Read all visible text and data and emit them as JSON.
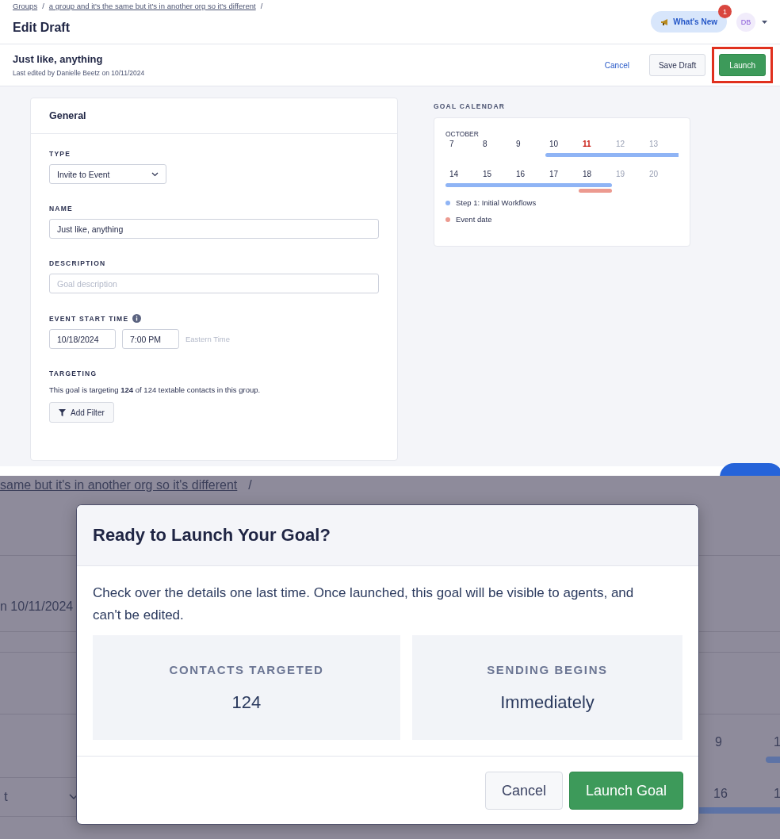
{
  "header": {
    "breadcrumbs": [
      {
        "label": "Groups"
      },
      {
        "label": "a group and it's the same but it's in another org so it's different"
      }
    ],
    "separator": "/",
    "title": "Edit Draft",
    "whats_new": {
      "label": "What's New",
      "badge": "1"
    },
    "avatar": "DB"
  },
  "draft_bar": {
    "name": "Just like, anything",
    "edited": "Last edited by Danielle Beetz on 10/11/2024",
    "buttons": [
      {
        "kind": "link",
        "label": "Cancel",
        "highlighted": false
      },
      {
        "kind": "secondary",
        "label": "Save Draft",
        "highlighted": false
      },
      {
        "kind": "primary",
        "label": "Launch",
        "highlighted": true
      }
    ]
  },
  "general": {
    "title": "General",
    "type": {
      "label": "TYPE",
      "value": "Invite to Event"
    },
    "name": {
      "label": "NAME",
      "value": "Just like, anything"
    },
    "description": {
      "label": "DESCRIPTION",
      "placeholder": "Goal description"
    },
    "event_start": {
      "label": "EVENT START TIME",
      "date": "10/18/2024",
      "time": "7:00 PM",
      "timezone": "Eastern Time"
    },
    "targeting": {
      "label": "TARGETING",
      "text": "This goal is targeting **124** of 124 textable contacts in this group.",
      "button": "Add Filter"
    }
  },
  "goal_calendar": {
    "title": "GOAL CALENDAR",
    "month": "OCTOBER",
    "weeks": [
      [
        {
          "day": "7",
          "kind": "normal",
          "step": false,
          "event": false
        },
        {
          "day": "8",
          "kind": "normal",
          "step": false,
          "event": false
        },
        {
          "day": "9",
          "kind": "normal",
          "step": false,
          "event": false
        },
        {
          "day": "10",
          "kind": "normal",
          "step": true,
          "event": false
        },
        {
          "day": "11",
          "kind": "today",
          "step": true,
          "event": false
        },
        {
          "day": "12",
          "kind": "weekend",
          "step": true,
          "event": false
        },
        {
          "day": "13",
          "kind": "weekend",
          "step": true,
          "event": false
        }
      ],
      [
        {
          "day": "14",
          "kind": "normal",
          "step": true,
          "event": false
        },
        {
          "day": "15",
          "kind": "normal",
          "step": true,
          "event": false
        },
        {
          "day": "16",
          "kind": "normal",
          "step": true,
          "event": false
        },
        {
          "day": "17",
          "kind": "normal",
          "step": true,
          "event": false
        },
        {
          "day": "18",
          "kind": "normal",
          "step": true,
          "event": true
        },
        {
          "day": "19",
          "kind": "weekend",
          "step": false,
          "event": false
        },
        {
          "day": "20",
          "kind": "weekend",
          "step": false,
          "event": false
        }
      ]
    ],
    "legend": [
      {
        "label": "Step 1: Initial Workflows",
        "color": "#8fb4f5"
      },
      {
        "label": "Event date",
        "color": "#ec9a90"
      }
    ]
  },
  "backdrop": {
    "breadcrumb_fragment": "same but it's in another org so it's different",
    "separator": "/",
    "edited_fragment": "n 10/11/2024",
    "type_fragment": "t",
    "calendar_fragments": [
      "9",
      "1",
      "16",
      "1"
    ]
  },
  "modal": {
    "title": "Ready to Launch Your Goal?",
    "message": "Check over the details one last time. Once launched, this goal will be visible to agents, and can't be edited.",
    "stats": [
      {
        "label": "CONTACTS TARGETED",
        "value": "124"
      },
      {
        "label": "SENDING BEGINS",
        "value": "Immediately"
      }
    ],
    "buttons": [
      {
        "kind": "secondary",
        "label": "Cancel"
      },
      {
        "kind": "primary",
        "label": "Launch Goal"
      }
    ]
  }
}
